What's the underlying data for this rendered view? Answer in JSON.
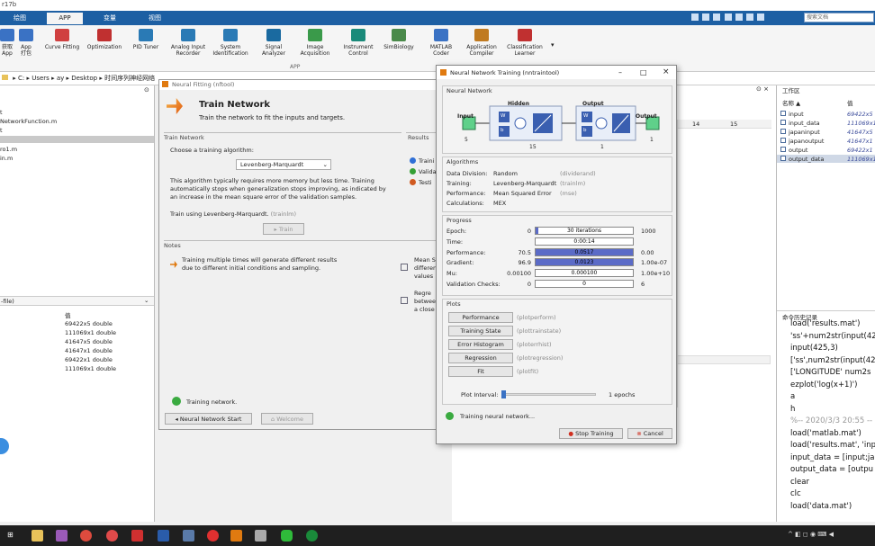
{
  "title_fragment": "r17b",
  "tabs": [
    "绘图",
    "APP",
    "变量",
    "视图"
  ],
  "ribbon": {
    "items": [
      {
        "label": "获取\nApp",
        "icon": "get-apps-icon",
        "color": "#3a72c4"
      },
      {
        "label": "App\n打包",
        "icon": "package-app-icon",
        "color": "#3a72c4"
      },
      {
        "label": "Curve Fitting",
        "icon": "curve-fitting-icon",
        "color": "#d04040"
      },
      {
        "label": "Optimization",
        "icon": "optimization-icon",
        "color": "#c03030"
      },
      {
        "label": "PID Tuner",
        "icon": "pid-tuner-icon",
        "color": "#2a7ab5"
      },
      {
        "label": "Analog Input\nRecorder",
        "icon": "analog-input-icon",
        "color": "#2a7ab5"
      },
      {
        "label": "System\nIdentification",
        "icon": "system-id-icon",
        "color": "#2a7ab5"
      },
      {
        "label": "Signal\nAnalyzer",
        "icon": "signal-analyzer-icon",
        "color": "#1a6aa0"
      },
      {
        "label": "Image\nAcquisition",
        "icon": "image-acquisition-icon",
        "color": "#3a9a4a"
      },
      {
        "label": "Instrument\nControl",
        "icon": "instrument-control-icon",
        "color": "#1a8a7a"
      },
      {
        "label": "SimBiology",
        "icon": "simbiology-icon",
        "color": "#4a8a4a"
      },
      {
        "label": "MATLAB\nCoder",
        "icon": "matlab-coder-icon",
        "color": "#3a72c4"
      },
      {
        "label": "Application\nCompiler",
        "icon": "app-compiler-icon",
        "color": "#c07a20"
      },
      {
        "label": "Classification\nLearner",
        "icon": "classification-learner-icon",
        "color": "#c03030"
      }
    ],
    "section_label": "APP"
  },
  "search_placeholder": "搜索文档",
  "path": [
    "C:",
    "Users",
    "ay",
    "Desktop",
    "时间序列神经网络"
  ],
  "left": {
    "files": [
      "t",
      "NetworkFunction.m",
      "t",
      "",
      "ro1.m",
      "in.m"
    ],
    "workspace_header": "-file)",
    "value_header": "值",
    "values": [
      "69422x5 double",
      "111069x1 double",
      "41647x5 double",
      "41647x1 double",
      "69422x1 double",
      "111069x1 double"
    ]
  },
  "nnfit": {
    "title": "Neural Fitting (nftool)",
    "heading": "Train Network",
    "subheading": "Train the network to fit the inputs and targets.",
    "train_group": "Train Network",
    "choose_label": "Choose a training algorithm:",
    "algorithm": "Levenberg-Marquardt",
    "description": "This algorithm typically requires more memory but less time. Training automatically stops when generalization stops improving, as indicated by an increase in the mean square error of the validation samples.",
    "train_using": "Train using Levenberg-Marquardt.",
    "train_using_fn": "(trainlm)",
    "train_button": "Train",
    "results_group": "Results",
    "results_items": [
      "Traini",
      "Valida",
      "Testi"
    ],
    "notes_group": "Notes",
    "note1": "Training multiple times will generate different results due to different initial conditions and sampling.",
    "note2_frag": "Mean S\ndifferen\nvalues",
    "note3_frag": "Regre\nbetwee\na close",
    "status": "Training network.",
    "btn_start": "Neural Network Start",
    "btn_welcome": "Welcome"
  },
  "nnt": {
    "title": "Neural Network Training (nntraintool)",
    "network_group": "Neural Network",
    "net": {
      "input": "Input",
      "input_n": "5",
      "hidden": "Hidden",
      "hidden_n": "15",
      "output_layer": "Output",
      "output_n": "1",
      "output": "Output",
      "output_count": "1",
      "w": "W",
      "b": "b"
    },
    "algorithms_group": "Algorithms",
    "algorithms": [
      {
        "k": "Data Division:",
        "v": "Random",
        "f": "(dividerand)"
      },
      {
        "k": "Training:",
        "v": "Levenberg-Marquardt",
        "f": "(trainlm)"
      },
      {
        "k": "Performance:",
        "v": "Mean Squared Error",
        "f": "(mse)"
      },
      {
        "k": "Calculations:",
        "v": "MEX",
        "f": ""
      }
    ],
    "progress_group": "Progress",
    "progress": [
      {
        "label": "Epoch:",
        "start": "0",
        "text": "30 iterations",
        "end": "1000",
        "fill": 0.03
      },
      {
        "label": "Time:",
        "start": "",
        "text": "0:00:14",
        "end": "",
        "fill": 0
      },
      {
        "label": "Performance:",
        "start": "70.5",
        "text": "0.0517",
        "end": "0.00",
        "fill": 1.0
      },
      {
        "label": "Gradient:",
        "start": "96.9",
        "text": "0.0123",
        "end": "1.00e-07",
        "fill": 1.0
      },
      {
        "label": "Mu:",
        "start": "0.00100",
        "text": "0.000100",
        "end": "1.00e+10",
        "fill": 0
      },
      {
        "label": "Validation Checks:",
        "start": "0",
        "text": "0",
        "end": "6",
        "fill": 0
      }
    ],
    "plots_group": "Plots",
    "plots": [
      {
        "btn": "Performance",
        "fn": "(plotperform)"
      },
      {
        "btn": "Training State",
        "fn": "(plottrainstate)"
      },
      {
        "btn": "Error Histogram",
        "fn": "(ploterrhist)"
      },
      {
        "btn": "Regression",
        "fn": "(plotregression)"
      },
      {
        "btn": "Fit",
        "fn": "(plotfit)"
      }
    ],
    "plot_interval_label": "Plot Interval:",
    "plot_interval_value": "1 epochs",
    "status": "Training neural network...",
    "stop_btn": "Stop Training",
    "cancel_btn": "Cancel"
  },
  "grid_cols": [
    "14",
    "15"
  ],
  "workspace": {
    "title": "工作区",
    "col_name": "名称 ▲",
    "col_value": "值",
    "vars": [
      {
        "name": "input",
        "val": "69422x5 d"
      },
      {
        "name": "input_data",
        "val": "111069x1"
      },
      {
        "name": "japaninput",
        "val": "41647x5 d"
      },
      {
        "name": "japanoutput",
        "val": "41647x1 d"
      },
      {
        "name": "output",
        "val": "69422x1 d"
      },
      {
        "name": "output_data",
        "val": "111069x1"
      }
    ],
    "history_title": "命令历史记录"
  },
  "history": [
    "load('results.mat')",
    "'ss'+num2str(input(42",
    "input(425,3)",
    "['ss',num2str(input(425",
    "['LONGITUDE' num2s",
    "ezplot('log(x+1)')",
    "a",
    "h",
    "%-- 2020/3/3 20:55 --",
    "load('matlab.mat')",
    "load('results.mat', 'inp",
    "input_data = [input;ja",
    "output_data = [outpu",
    "clear",
    "clc",
    "load('data.mat')"
  ]
}
